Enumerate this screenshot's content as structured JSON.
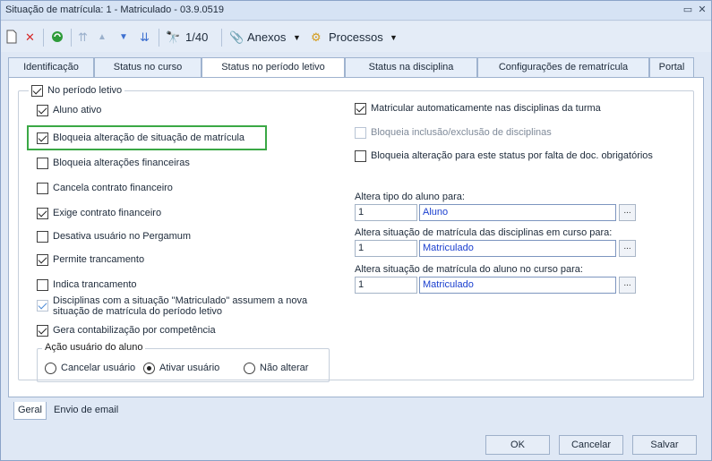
{
  "window": {
    "title": "Situação de matrícula: 1 - Matriculado - 03.9.0519"
  },
  "toolbar": {
    "record_position": "1/40",
    "anexos_label": "Anexos",
    "processos_label": "Processos"
  },
  "tabs": [
    {
      "label": "Identificação"
    },
    {
      "label": "Status no curso"
    },
    {
      "label": "Status no período letivo"
    },
    {
      "label": "Status na disciplina"
    },
    {
      "label": "Configurações de rematrícula"
    },
    {
      "label": "Portal"
    }
  ],
  "periodo": {
    "group_label": "No período letivo",
    "group_checked": true,
    "left_options": [
      {
        "label": "Aluno ativo",
        "checked": true
      },
      {
        "label": "Bloqueia alteração de situação de matrícula",
        "checked": true
      },
      {
        "label": "Bloqueia alterações financeiras",
        "checked": false
      },
      {
        "label": "Cancela contrato financeiro",
        "checked": false
      },
      {
        "label": "Exige contrato financeiro",
        "checked": true
      },
      {
        "label": "Desativa usuário no Pergamum",
        "checked": false
      },
      {
        "label": "Permite trancamento",
        "checked": true
      },
      {
        "label": "Indica trancamento",
        "checked": false
      },
      {
        "label": "Disciplinas com a situação \"Matriculado\" assumem a nova situação de matrícula do período letivo",
        "checked": true
      },
      {
        "label": "Gera contabilização por competência",
        "checked": true
      }
    ],
    "right_options": [
      {
        "label": "Matricular automaticamente nas disciplinas da turma",
        "checked": true
      },
      {
        "label": "Bloqueia inclusão/exclusão de disciplinas",
        "checked": false
      },
      {
        "label": "Bloqueia alteração para este status por falta de doc. obrigatórios",
        "checked": false
      }
    ],
    "fields": [
      {
        "label": "Altera tipo do aluno para:",
        "code": "1",
        "name": "Aluno"
      },
      {
        "label": "Altera situação de matrícula das disciplinas em curso para:",
        "code": "1",
        "name": "Matriculado"
      },
      {
        "label": "Altera situação de matrícula do aluno no curso para:",
        "code": "1",
        "name": "Matriculado"
      }
    ],
    "acao": {
      "label": "Ação usuário do aluno",
      "options": [
        {
          "label": "Cancelar usuário",
          "checked": false
        },
        {
          "label": "Ativar usuário",
          "checked": true
        },
        {
          "label": "Não alterar",
          "checked": false
        }
      ]
    }
  },
  "bottom_tabs": [
    {
      "label": "Geral"
    },
    {
      "label": "Envio de email"
    }
  ],
  "buttons": {
    "ok": "OK",
    "cancel": "Cancelar",
    "save": "Salvar"
  },
  "ellipsis": "...",
  "colors": {
    "highlight": "#3aa845",
    "link_blue": "#1a3fcf"
  }
}
